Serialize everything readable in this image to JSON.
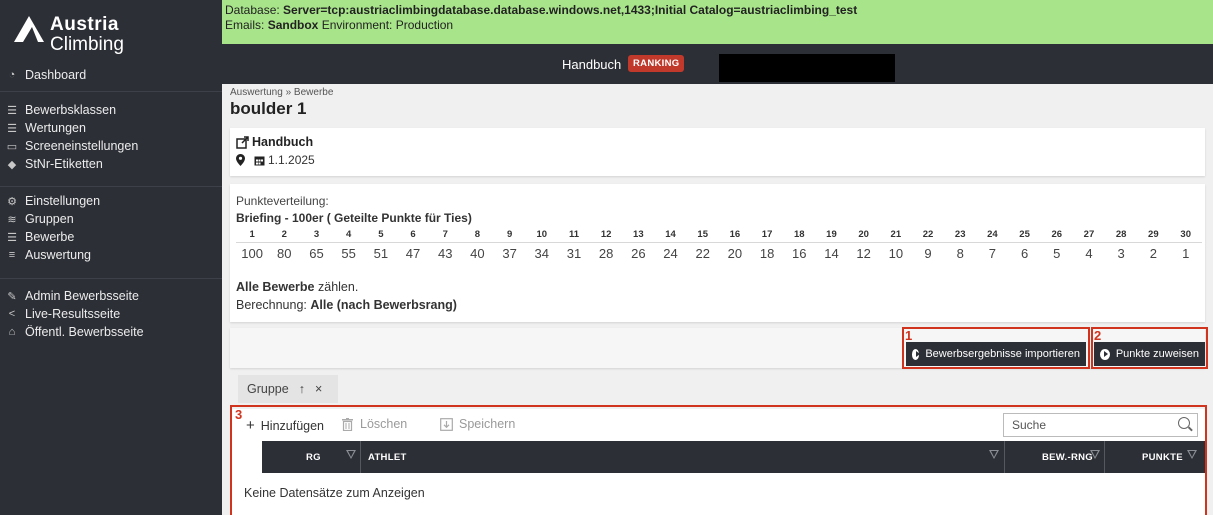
{
  "app": {
    "logo_line1": "Austria",
    "logo_line2": "Climbing"
  },
  "sidebar": {
    "group1": [
      {
        "icon": "dashboard-icon",
        "label": "Dashboard"
      }
    ],
    "group2": [
      {
        "icon": "list-icon",
        "label": "Bewerbsklassen"
      },
      {
        "icon": "list-icon",
        "label": "Wertungen"
      },
      {
        "icon": "monitor-icon",
        "label": "Screeneinstellungen"
      },
      {
        "icon": "tag-icon",
        "label": "StNr-Etiketten"
      }
    ],
    "group3": [
      {
        "icon": "cogs-icon",
        "label": "Einstellungen"
      },
      {
        "icon": "layers-icon",
        "label": "Gruppen"
      },
      {
        "icon": "list-icon",
        "label": "Bewerbe"
      },
      {
        "icon": "ranking-icon",
        "label": "Auswertung"
      }
    ],
    "group4": [
      {
        "icon": "edit-icon",
        "label": "Admin Bewerbsseite"
      },
      {
        "icon": "share-icon",
        "label": "Live-Resultsseite"
      },
      {
        "icon": "home-icon",
        "label": "Öffentl. Bewerbsseite"
      }
    ]
  },
  "banner": {
    "db_prefix": "Database: ",
    "db_value": "Server=tcp:austriaclimbingdatabase.database.windows.net,1433;Initial Catalog=austriaclimbing_test",
    "emails_prefix": "Emails: ",
    "emails_value": "Sandbox",
    "env_text": " Environment: Production"
  },
  "topbar": {
    "title": "Handbuch",
    "badge": "RANKING"
  },
  "page": {
    "breadcrumb": "Auswertung » Bewerbe",
    "title": "boulder 1"
  },
  "event": {
    "link_label": "Handbuch",
    "date": "1.1.2025"
  },
  "points": {
    "label": "Punkteverteilung:",
    "scheme": "Briefing - 100er ( Geteilte Punkte für Ties)",
    "ranks": [
      "1",
      "2",
      "3",
      "4",
      "5",
      "6",
      "7",
      "8",
      "9",
      "10",
      "11",
      "12",
      "13",
      "14",
      "15",
      "16",
      "17",
      "18",
      "19",
      "20",
      "21",
      "22",
      "23",
      "24",
      "25",
      "26",
      "27",
      "28",
      "29",
      "30"
    ],
    "values": [
      "100",
      "80",
      "65",
      "55",
      "51",
      "47",
      "43",
      "40",
      "37",
      "34",
      "31",
      "28",
      "26",
      "24",
      "22",
      "20",
      "18",
      "16",
      "14",
      "12",
      "10",
      "9",
      "8",
      "7",
      "6",
      "5",
      "4",
      "3",
      "2",
      "1"
    ],
    "count_bold": "Alle Bewerbe",
    "count_rest": " zählen.",
    "calc_label": "Berechnung: ",
    "calc_value": "Alle (nach Bewerbsrang)"
  },
  "actions": {
    "marker1": "1",
    "marker2": "2",
    "marker3": "3",
    "import_label": "Bewerbsergebnisse importieren",
    "assign_label": "Punkte zuweisen"
  },
  "group_chip": {
    "label": "Gruppe",
    "sort": "↑",
    "remove": "×"
  },
  "grid": {
    "add_label": "Hinzufügen",
    "delete_label": "Löschen",
    "save_label": "Speichern",
    "search_placeholder": "Suche",
    "columns": [
      "RG",
      "ATHLET",
      "BEW.-RNG",
      "PUNKTE"
    ],
    "empty_text": "Keine Datensätze zum Anzeigen"
  },
  "colors": {
    "sidebar_bg": "#2c2f36",
    "banner_bg": "#a8e58a",
    "badge_red": "#c0392b",
    "annotation_red": "#d0341e"
  }
}
